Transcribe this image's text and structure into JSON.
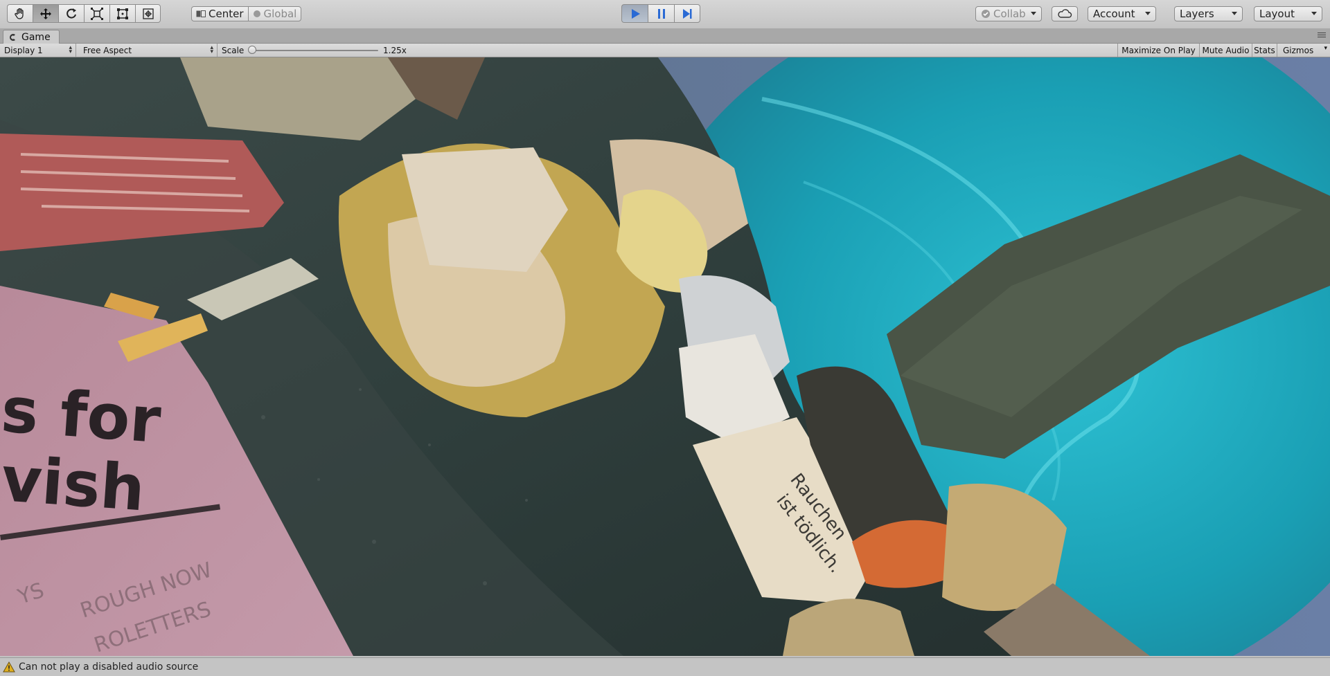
{
  "toolbar": {
    "tools": [
      {
        "name": "hand-tool",
        "icon": "hand-icon"
      },
      {
        "name": "move-tool",
        "icon": "move-arrows-icon"
      },
      {
        "name": "rotate-tool",
        "icon": "rotate-icon"
      },
      {
        "name": "scale-tool",
        "icon": "scale-icon"
      },
      {
        "name": "rect-tool",
        "icon": "rect-transform-icon"
      },
      {
        "name": "transform-tool",
        "icon": "transform-icon"
      }
    ],
    "pivot": {
      "center_label": "Center",
      "global_label": "Global"
    },
    "playback": {
      "play_icon": "play-icon",
      "pause_icon": "pause-icon",
      "step_icon": "step-icon",
      "play_active": true
    },
    "collab_label": "Collab",
    "cloud_icon": "cloud-icon",
    "account_label": "Account",
    "layers_label": "Layers",
    "layout_label": "Layout"
  },
  "game_window": {
    "tab_label": "Game",
    "display_label": "Display 1",
    "aspect_label": "Free Aspect",
    "scale_label": "Scale",
    "scale_value": "1.25x",
    "maximize_label": "Maximize On Play",
    "mute_label": "Mute Audio",
    "stats_label": "Stats",
    "gizmos_label": "Gizmos"
  },
  "scene": {
    "poster_text": [
      "s for",
      "vish"
    ],
    "poster_small_text": [
      "YS",
      "ROUGH NOW",
      "ROLETTERS"
    ],
    "pack_text": [
      "Rauchen",
      "ist tödlich."
    ]
  },
  "status": {
    "message": "Can not play a disabled audio source",
    "icon": "warning-icon"
  },
  "colors": {
    "accent_play": "#2a6ad4",
    "toolbar_bg": "#c4c4c4",
    "water": "#1fa6b8"
  }
}
